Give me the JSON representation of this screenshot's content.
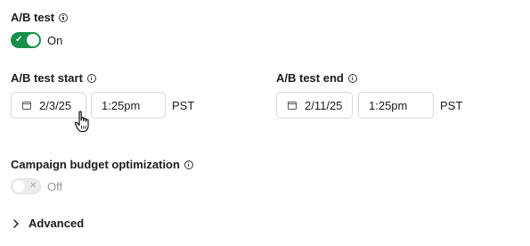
{
  "ab_test": {
    "label": "A/B test",
    "toggle_state": "On",
    "enabled": true
  },
  "ab_test_start": {
    "label": "A/B test start",
    "date": "2/3/25",
    "time": "1:25pm",
    "timezone": "PST"
  },
  "ab_test_end": {
    "label": "A/B test end",
    "date": "2/11/25",
    "time": "1:25pm",
    "timezone": "PST"
  },
  "campaign_budget": {
    "label": "Campaign budget optimization",
    "toggle_state": "Off",
    "enabled": false
  },
  "advanced": {
    "label": "Advanced"
  },
  "colors": {
    "toggle_on": "#1a8f4c",
    "toggle_off": "#ececec"
  },
  "icons": [
    "info-icon",
    "check-icon",
    "close-icon",
    "calendar-icon",
    "chevron-right-icon",
    "hand-pointer-cursor-icon"
  ]
}
